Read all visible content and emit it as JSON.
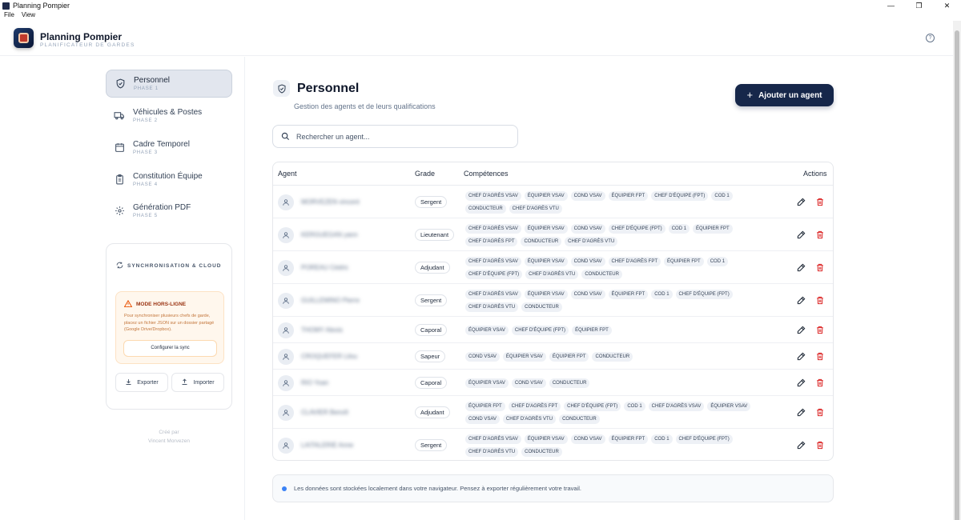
{
  "window": {
    "title": "Planning Pompier",
    "minimize": "—",
    "maximize": "❐",
    "close": "✕"
  },
  "menu": [
    "File",
    "View"
  ],
  "header": {
    "title": "Planning Pompier",
    "subtitle": "PLANIFICATEUR DE GARDES",
    "help_icon": "question-circle-icon",
    "help_glyph": "?"
  },
  "sidebar": {
    "items": [
      {
        "label": "Personnel",
        "phase": "PHASE 1",
        "icon": "shield-icon",
        "active": true
      },
      {
        "label": "Véhicules & Postes",
        "phase": "PHASE 2",
        "icon": "truck-icon",
        "active": false
      },
      {
        "label": "Cadre Temporel",
        "phase": "PHASE 3",
        "icon": "calendar-icon",
        "active": false
      },
      {
        "label": "Constitution Équipe",
        "phase": "PHASE 4",
        "icon": "clipboard-icon",
        "active": false
      },
      {
        "label": "Génération PDF",
        "phase": "PHASE 5",
        "icon": "gear-icon",
        "active": false
      }
    ],
    "sync": {
      "title": "SYNCHRONISATION & CLOUD",
      "offline_title": "MODE HORS-LIGNE",
      "offline_desc": "Pour synchroniser plusieurs chefs de garde, placez un fichier JSON sur un dossier partagé (Google Drive/Dropbox).",
      "config_label": "Configurer la sync",
      "export_label": "Exporter",
      "import_label": "Importer"
    },
    "credit_line1": "Créé par",
    "credit_line2": "Vincent Morvezen"
  },
  "main": {
    "title": "Personnel",
    "subtitle": "Gestion des agents et de leurs qualifications",
    "add_button": "Ajouter un agent",
    "add_plus": "+",
    "search_placeholder": "Rechercher un agent...",
    "columns": {
      "agent": "Agent",
      "grade": "Grade",
      "skills": "Compétences",
      "actions": "Actions"
    },
    "info": "Les données sont stockées localement dans votre navigateur. Pensez à exporter régulièrement votre travail."
  },
  "agents": [
    {
      "name": "MORVEZEN vincent",
      "grade": "Sergent",
      "skills": [
        "CHEF D'AGRÈS VSAV",
        "ÉQUIPIER VSAV",
        "COND VSAV",
        "ÉQUIPIER FPT",
        "CHEF D'ÉQUIPE (FPT)",
        "COD 1",
        "CONDUCTEUR",
        "CHEF D'AGRÈS VTU"
      ]
    },
    {
      "name": "KERGUEGAN yann",
      "grade": "Lieutenant",
      "skills": [
        "CHEF D'AGRÈS VSAV",
        "ÉQUIPIER VSAV",
        "COND VSAV",
        "CHEF D'ÉQUIPE (FPT)",
        "COD 1",
        "ÉQUIPIER FPT",
        "CHEF D'AGRÈS FPT",
        "CONDUCTEUR",
        "CHEF D'AGRÈS VTU"
      ]
    },
    {
      "name": "POREAU Cédric",
      "grade": "Adjudant",
      "skills": [
        "CHEF D'AGRÈS VSAV",
        "ÉQUIPIER VSAV",
        "COND VSAV",
        "CHEF D'AGRÈS FPT",
        "ÉQUIPIER FPT",
        "COD 1",
        "CHEF D'ÉQUIPE (FPT)",
        "CHEF D'AGRÈS VTU",
        "CONDUCTEUR"
      ]
    },
    {
      "name": "GUILLEMINO Pierre",
      "grade": "Sergent",
      "skills": [
        "CHEF D'AGRÈS VSAV",
        "ÉQUIPIER VSAV",
        "COND VSAV",
        "ÉQUIPIER FPT",
        "COD 1",
        "CHEF D'ÉQUIPE (FPT)",
        "CHEF D'AGRÈS VTU",
        "CONDUCTEUR"
      ]
    },
    {
      "name": "THOMY Alexis",
      "grade": "Caporal",
      "skills": [
        "ÉQUIPIER VSAV",
        "CHEF D'ÉQUIPE (FPT)",
        "ÉQUIPIER FPT"
      ]
    },
    {
      "name": "CROQUEFER Lilou",
      "grade": "Sapeur",
      "skills": [
        "COND VSAV",
        "ÉQUIPIER VSAV",
        "ÉQUIPIER FPT",
        "CONDUCTEUR"
      ]
    },
    {
      "name": "RIO Yoan",
      "grade": "Caporal",
      "skills": [
        "ÉQUIPIER VSAV",
        "COND VSAV",
        "CONDUCTEUR"
      ]
    },
    {
      "name": "CLAVIER Benoît",
      "grade": "Adjudant",
      "skills": [
        "ÉQUIPIER FPT",
        "CHEF D'AGRÈS FPT",
        "CHEF D'ÉQUIPE (FPT)",
        "COD 1",
        "CHEF D'AGRÈS VSAV",
        "ÉQUIPIER VSAV",
        "COND VSAV",
        "CHEF D'AGRÈS VTU",
        "CONDUCTEUR"
      ]
    },
    {
      "name": "LAITALERIE Anne",
      "grade": "Sergent",
      "skills": [
        "CHEF D'AGRÈS VSAV",
        "ÉQUIPIER VSAV",
        "COND VSAV",
        "ÉQUIPIER FPT",
        "COD 1",
        "CHEF D'ÉQUIPE (FPT)",
        "CHEF D'AGRÈS VTU",
        "CONDUCTEUR"
      ]
    }
  ],
  "colors": {
    "primary": "#16274a",
    "danger": "#dc2626",
    "chip_bg": "#eef1f6",
    "warning": "#ea580c",
    "info": "#3b82f6"
  }
}
